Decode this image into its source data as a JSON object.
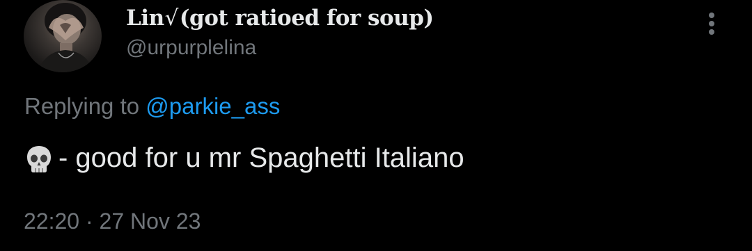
{
  "author": {
    "display_name": "Lin",
    "name_glyph": "√",
    "name_suffix": "(got ratioed for soup)",
    "handle": "@urpurplelina",
    "avatar_icon": "profile-photo"
  },
  "reply": {
    "prefix": "Replying to",
    "mention": "@parkie_ass"
  },
  "tweet": {
    "emoji_icon": "skull-emoji",
    "text": "- good for u mr Spaghetti Italiano"
  },
  "meta": {
    "time": "22:20",
    "separator": "·",
    "date": "27 Nov 23"
  },
  "menu": {
    "icon": "more-vertical-icon"
  },
  "colors": {
    "background": "#000000",
    "primary_text": "#e7e9ea",
    "secondary_text": "#71767b",
    "link": "#1d9bf0"
  }
}
